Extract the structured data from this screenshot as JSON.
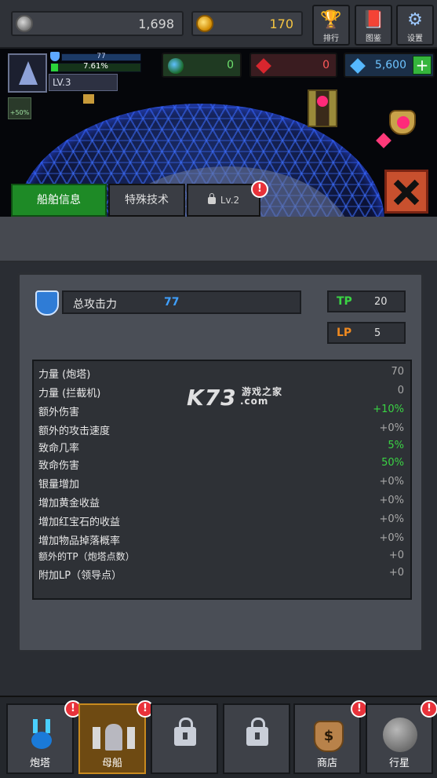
{
  "resources": {
    "silver": "1,698",
    "gold": "170",
    "planet": "0",
    "ruby": "0",
    "diamond": "5,600"
  },
  "top_buttons": {
    "rank": "排行",
    "codex": "图鉴",
    "settings": "设置"
  },
  "player": {
    "hp": "77",
    "xp_percent": "7.61%",
    "xp_fraction": 0.0761,
    "level": "LV.3",
    "boost": "+50%"
  },
  "tabs": {
    "ship_info": "船舶信息",
    "special_tech": "特殊技术",
    "locked_level": "Lv.2"
  },
  "stats": {
    "attack_label": "总攻击力",
    "attack_value": "77",
    "tp_label": "TP",
    "tp_value": "20",
    "lp_label": "LP",
    "lp_value": "5",
    "rows": [
      {
        "name": "力量 (炮塔)",
        "value": "70"
      },
      {
        "name": "力量 (拦截机)",
        "value": "0"
      },
      {
        "name": "额外伤害",
        "value": "+10%"
      },
      {
        "name": "额外的攻击速度",
        "value": "+0%"
      },
      {
        "name": "致命几率",
        "value": "5%"
      },
      {
        "name": "致命伤害",
        "value": "50%"
      },
      {
        "name": "银量增加",
        "value": "+0%"
      },
      {
        "name": "增加黄金收益",
        "value": "+0%"
      },
      {
        "name": "增加红宝石的收益",
        "value": "+0%"
      },
      {
        "name": "增加物品掉落概率",
        "value": "+0%"
      },
      {
        "name": "额外的TP（炮塔点数）",
        "value": "+0"
      },
      {
        "name": "附加LP（领导点）",
        "value": "+0"
      }
    ]
  },
  "watermark": {
    "brand": "K73",
    "text": "游戏之家",
    "domain": ".com"
  },
  "bottom_nav": {
    "turret": "炮塔",
    "mothership": "母船",
    "shop": "商店",
    "planet": "行星"
  },
  "colors": {
    "accent_green": "#1e8a26",
    "value_green": "#3ad444",
    "attack_blue": "#3fa0ff",
    "tp_color": "#3ad444",
    "lp_color": "#f08a20",
    "alert_red": "#e8323a"
  }
}
